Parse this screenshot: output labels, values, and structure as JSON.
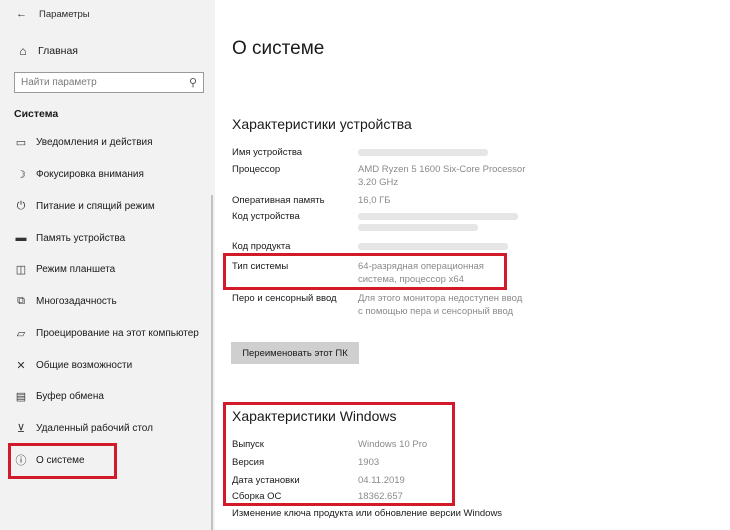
{
  "window": {
    "title": "Параметры"
  },
  "sidebar": {
    "home_label": "Главная",
    "search_placeholder": "Найти параметр",
    "section_title": "Система",
    "items": [
      {
        "icon": "monitor-icon",
        "label": "Уведомления и действия"
      },
      {
        "icon": "moon-icon",
        "label": "Фокусировка внимания"
      },
      {
        "icon": "power-icon",
        "label": "Питание и спящий режим"
      },
      {
        "icon": "storage-icon",
        "label": "Память устройства"
      },
      {
        "icon": "tablet-icon",
        "label": "Режим планшета"
      },
      {
        "icon": "multitask-icon",
        "label": "Многозадачность"
      },
      {
        "icon": "project-icon",
        "label": "Проецирование на этот компьютер"
      },
      {
        "icon": "share-icon",
        "label": "Общие возможности"
      },
      {
        "icon": "clipboard-icon",
        "label": "Буфер обмена"
      },
      {
        "icon": "remote-icon",
        "label": "Удаленный рабочий стол"
      },
      {
        "icon": "info-icon",
        "label": "О системе",
        "selected": true
      }
    ]
  },
  "main": {
    "title": "О системе",
    "device_specs": {
      "heading": "Характеристики устройства",
      "device_name_label": "Имя устройства",
      "processor_label": "Процессор",
      "processor_value": "AMD Ryzen 5 1600 Six-Core Processor 3.20 GHz",
      "ram_label": "Оперативная память",
      "ram_value": "16,0 ГБ",
      "device_id_label": "Код устройства",
      "product_id_label": "Код продукта",
      "system_type_label": "Тип системы",
      "system_type_value": "64-разрядная операционная система, процессор x64",
      "pen_label": "Перо и сенсорный ввод",
      "pen_value": "Для этого монитора недоступен ввод с помощью пера и сенсорный ввод",
      "rename_button": "Переименовать этот ПК"
    },
    "windows_specs": {
      "heading": "Характеристики Windows",
      "edition_label": "Выпуск",
      "edition_value": "Windows 10 Pro",
      "version_label": "Версия",
      "version_value": "1903",
      "installed_label": "Дата установки",
      "installed_value": "04.11.2019",
      "build_label": "Сборка ОС",
      "build_value": "18362.657"
    },
    "change_key_link": "Изменение ключа продукта или обновление версии Windows"
  },
  "colors": {
    "highlight": "#d11a2a",
    "sidebar_bg": "#f2f2f2",
    "value_text": "#8a8a8a"
  }
}
